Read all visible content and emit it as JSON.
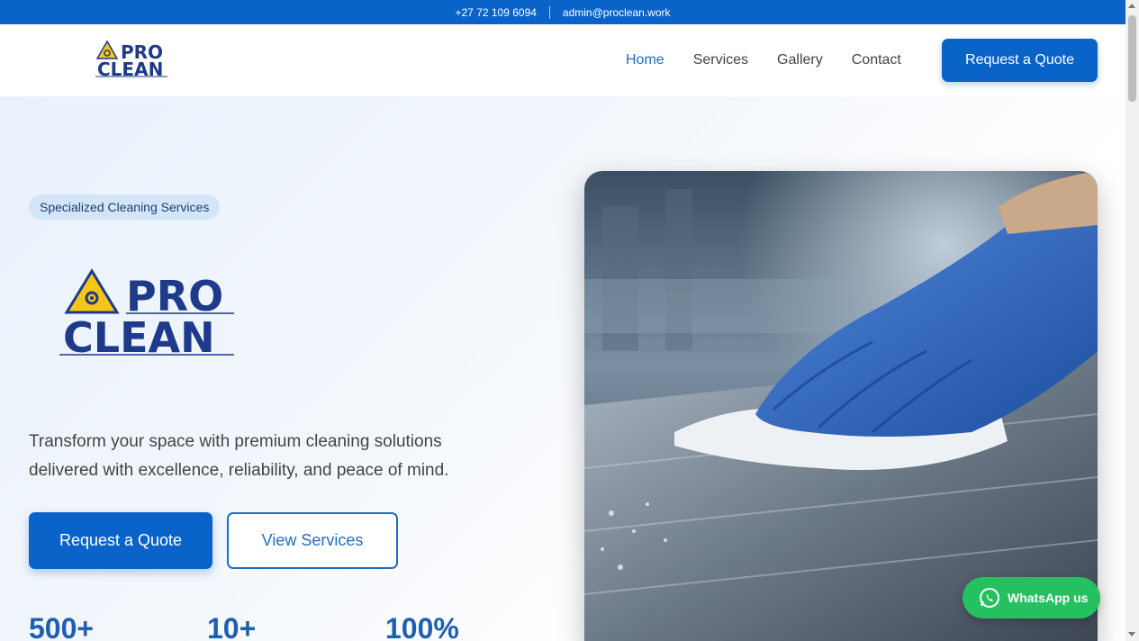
{
  "topbar": {
    "phone": "+27 72 109 6094",
    "email": "admin@proclean.work"
  },
  "logo": {
    "line1": "PRO",
    "line2": "CLEAN"
  },
  "nav": {
    "items": [
      {
        "label": "Home",
        "active": true
      },
      {
        "label": "Services",
        "active": false
      },
      {
        "label": "Gallery",
        "active": false
      },
      {
        "label": "Contact",
        "active": false
      }
    ]
  },
  "header": {
    "cta_label": "Request a Quote"
  },
  "hero": {
    "badge": "Specialized Cleaning Services",
    "tagline_line1": "Transform your space with premium cleaning solutions",
    "tagline_line2": "delivered with excellence, reliability, and peace of mind.",
    "primary_button": "Request a Quote",
    "secondary_button": "View Services",
    "stats": [
      {
        "value": "500+"
      },
      {
        "value": "10+"
      },
      {
        "value": "100%"
      }
    ]
  },
  "whatsapp": {
    "label": "WhatsApp us"
  },
  "colors": {
    "brand_blue": "#0a63c9",
    "logo_navy": "#1e3a8a",
    "hazard_yellow": "#f5c518",
    "whatsapp_green": "#25c160"
  }
}
